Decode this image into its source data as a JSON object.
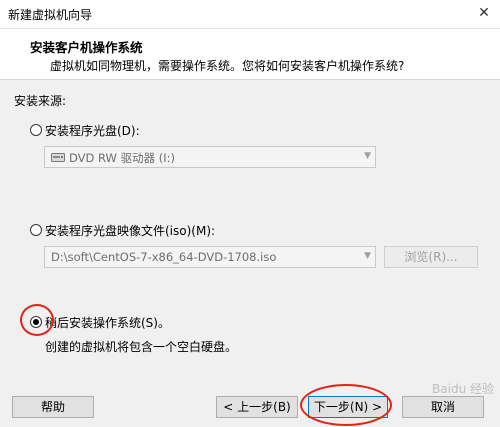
{
  "window": {
    "title": "新建虚拟机向导"
  },
  "header": {
    "title": "安装客户机操作系统",
    "subtitle": "虚拟机如同物理机，需要操作系统。您将如何安装客户机操作系统?"
  },
  "install_source": {
    "label": "安装来源:",
    "options": [
      {
        "label": "安装程序光盘(D):",
        "selected": false
      },
      {
        "label": "安装程序光盘映像文件(iso)(M):",
        "selected": false
      },
      {
        "label": "稍后安装操作系统(S)。",
        "selected": true
      }
    ],
    "disc_drive": "DVD RW 驱动器 (I:)",
    "iso_path": "D:\\soft\\CentOS-7-x86_64-DVD-1708.iso",
    "browse_label": "浏览(R)...",
    "later_description": "创建的虚拟机将包含一个空白硬盘。"
  },
  "buttons": {
    "help": "帮助",
    "back": "< 上一步(B)",
    "next": "下一步(N) >",
    "cancel": "取消"
  },
  "watermark": "Baidu 经验",
  "colors": {
    "annotation_red": "#e2231a",
    "default_button_border": "#0078d7"
  }
}
